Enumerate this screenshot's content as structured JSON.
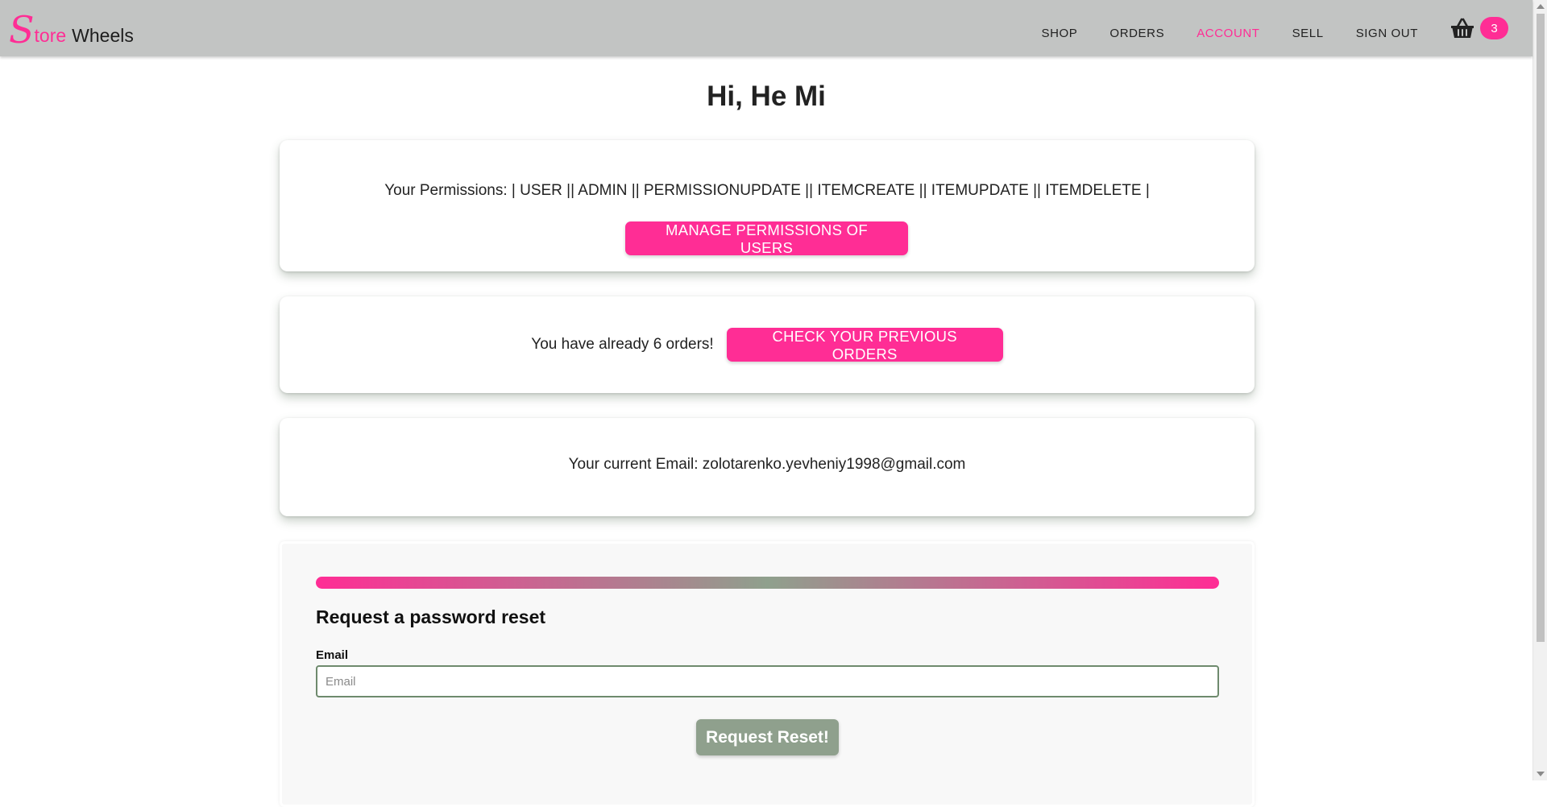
{
  "header": {
    "logo": {
      "s": "S",
      "tore": "tore",
      "wheels": "Wheels"
    },
    "nav": [
      {
        "label": "SHOP"
      },
      {
        "label": "ORDERS"
      },
      {
        "label": "ACCOUNT",
        "active": true
      },
      {
        "label": "SELL"
      },
      {
        "label": "SIGN OUT"
      }
    ],
    "cart": {
      "icon": "basket-icon",
      "count": "3"
    }
  },
  "main": {
    "greeting": "Hi, He Mi",
    "permissions": {
      "text": "Your Permissions: | USER || ADMIN || PERMISSIONUPDATE || ITEMCREATE || ITEMUPDATE || ITEMDELETE |",
      "button": "MANAGE PERMISSIONS OF USERS"
    },
    "orders": {
      "text": "You have already 6 orders!",
      "button": "CHECK YOUR PREVIOUS ORDERS"
    },
    "email": {
      "text": "Your current Email: zolotarenko.yevheniy1998@gmail.com"
    },
    "reset": {
      "title": "Request a password reset",
      "email_label": "Email",
      "email_placeholder": "Email",
      "email_value": "",
      "button": "Request Reset!"
    }
  },
  "colors": {
    "accent": "#ff2d95",
    "header_bg": "#c2c4c3",
    "sage": "#8fa08d",
    "input_border": "#6e8a6d"
  }
}
